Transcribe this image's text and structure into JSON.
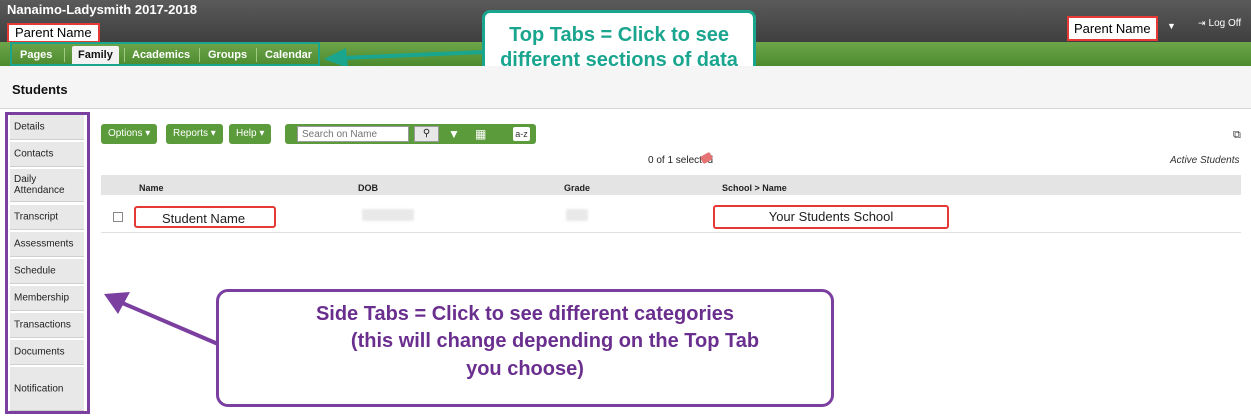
{
  "header": {
    "school_name": "Nanaimo-Ladysmith 2017-2018",
    "parent_name_left": "Parent Name",
    "parent_name_right": "Parent Name",
    "logoff": "Log Off"
  },
  "top_tabs": [
    "Pages",
    "Family",
    "Academics",
    "Groups",
    "Calendar"
  ],
  "active_top_tab": "Family",
  "callout_top": {
    "line1": "Top Tabs  = Click to see",
    "line2": "different sections of data"
  },
  "page_title": "Students",
  "side_tabs": [
    "Details",
    "Contacts",
    "Daily Attendance",
    "Transcript",
    "Assessments",
    "Schedule",
    "Membership",
    "Transactions",
    "Documents",
    "Notification"
  ],
  "toolbar": {
    "options": "Options",
    "reports": "Reports",
    "help": "Help",
    "search_placeholder": "Search on Name",
    "az": "a-z"
  },
  "selection": {
    "count_text": "0 of 1 selected",
    "filter_text": "Active Students"
  },
  "table": {
    "columns": [
      "Name",
      "DOB",
      "Grade",
      "School > Name"
    ],
    "row": {
      "name": "Student Name",
      "school": "Your Students School"
    }
  },
  "callout_side": {
    "line1": "Side Tabs = Click to see different categories",
    "line2": "(this will change depending on the Top Tab",
    "line3": "you choose)"
  },
  "colors": {
    "nav_green": "#5b9b3b",
    "teal_callout": "#1aa58f",
    "purple_callout": "#7b3fa0",
    "red_highlight": "#e53935"
  },
  "icons": [
    "search-icon",
    "filter-icon",
    "columns-icon",
    "expand-icon",
    "eraser-icon",
    "logoff-icon",
    "chevron-down-icon"
  ]
}
